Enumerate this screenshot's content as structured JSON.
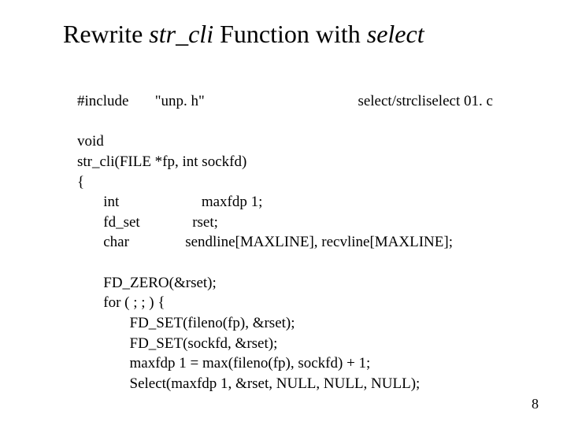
{
  "title": {
    "prefix": "Rewrite ",
    "ident": "str_cli",
    "mid": " Function with ",
    "tail": "select"
  },
  "code": {
    "line1a": "#include",
    "line1b": "\"unp. h\"",
    "line1c": "select/strcliselect 01. c",
    "line2": "void",
    "line3": "str_cli(FILE *fp, int sockfd)",
    "line4": "{",
    "line5a": "int",
    "line5b": "maxfdp 1;",
    "line6a": "fd_set",
    "line6b": "rset;",
    "line7a": "char",
    "line7b": "sendline[MAXLINE], recvline[MAXLINE];",
    "line8": "FD_ZERO(&rset);",
    "line9": "for ( ; ; ) {",
    "line10": "FD_SET(fileno(fp), &rset);",
    "line11": "FD_SET(sockfd, &rset);",
    "line12": "maxfdp 1 = max(fileno(fp), sockfd) + 1;",
    "line13": "Select(maxfdp 1, &rset, NULL, NULL, NULL);"
  },
  "page_number": "8"
}
